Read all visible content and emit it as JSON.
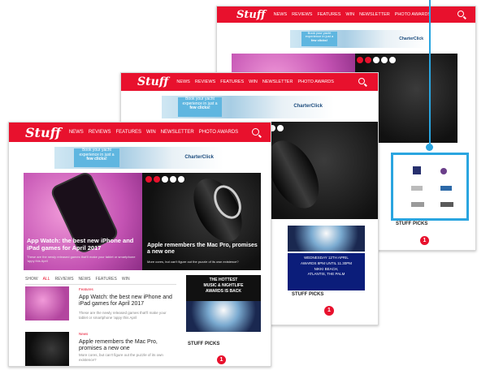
{
  "site": {
    "logo": "Stuff",
    "nav_items": [
      "NEWS",
      "REVIEWS",
      "FEATURES",
      "WIN",
      "NEWSLETTER",
      "PHOTO AWARDS"
    ]
  },
  "banner": {
    "book_line1": "Book your yacht",
    "book_line2": "experience in just a",
    "book_line3": "few clicks!",
    "charter": "CharterClick"
  },
  "hero": {
    "left_title": "App Watch: the best new iPhone and iPad games for April 2017",
    "left_sub": "These are the newly released games that'll make your tablet or smartphone 'appy this April",
    "right_title": "Apple remembers the Mac Pro, promises a new one",
    "right_sub": "More cores, but can't figure out the puzzle of its own existence?"
  },
  "tabs": [
    "SHOW",
    "ALL",
    "REVIEWS",
    "NEWS",
    "FEATURES",
    "WIN"
  ],
  "articles": [
    {
      "category": "Features",
      "title": "App Watch: the best new iPhone and iPad games for April 2017",
      "body": "These are the newly released games that'll make your tablet or smartphone 'appy this April"
    },
    {
      "category": "News",
      "title": "Apple remembers the Mac Pro, promises a new one",
      "body": "More cores, but can't figure out the puzzle of its own existence?"
    }
  ],
  "sidebar": {
    "hottest_line1": "THE HOTTEST",
    "hottest_line2": "MUSIC & NIGHTLIFE",
    "hottest_line3": "AWARDS IS BACK",
    "promo_line1": "WEDNESDAY 12TH APRIL",
    "promo_line2": "AWARDS 8PM UNTIL 11.30PM",
    "promo_line3": "NIKKI BEACH,",
    "promo_line4": "ATLANTIS, THE PALM",
    "picks_title": "STUFF PICKS",
    "picks_number": "1"
  },
  "colors": {
    "brand_red": "#e8112d",
    "highlight_blue": "#2aa5e0"
  }
}
